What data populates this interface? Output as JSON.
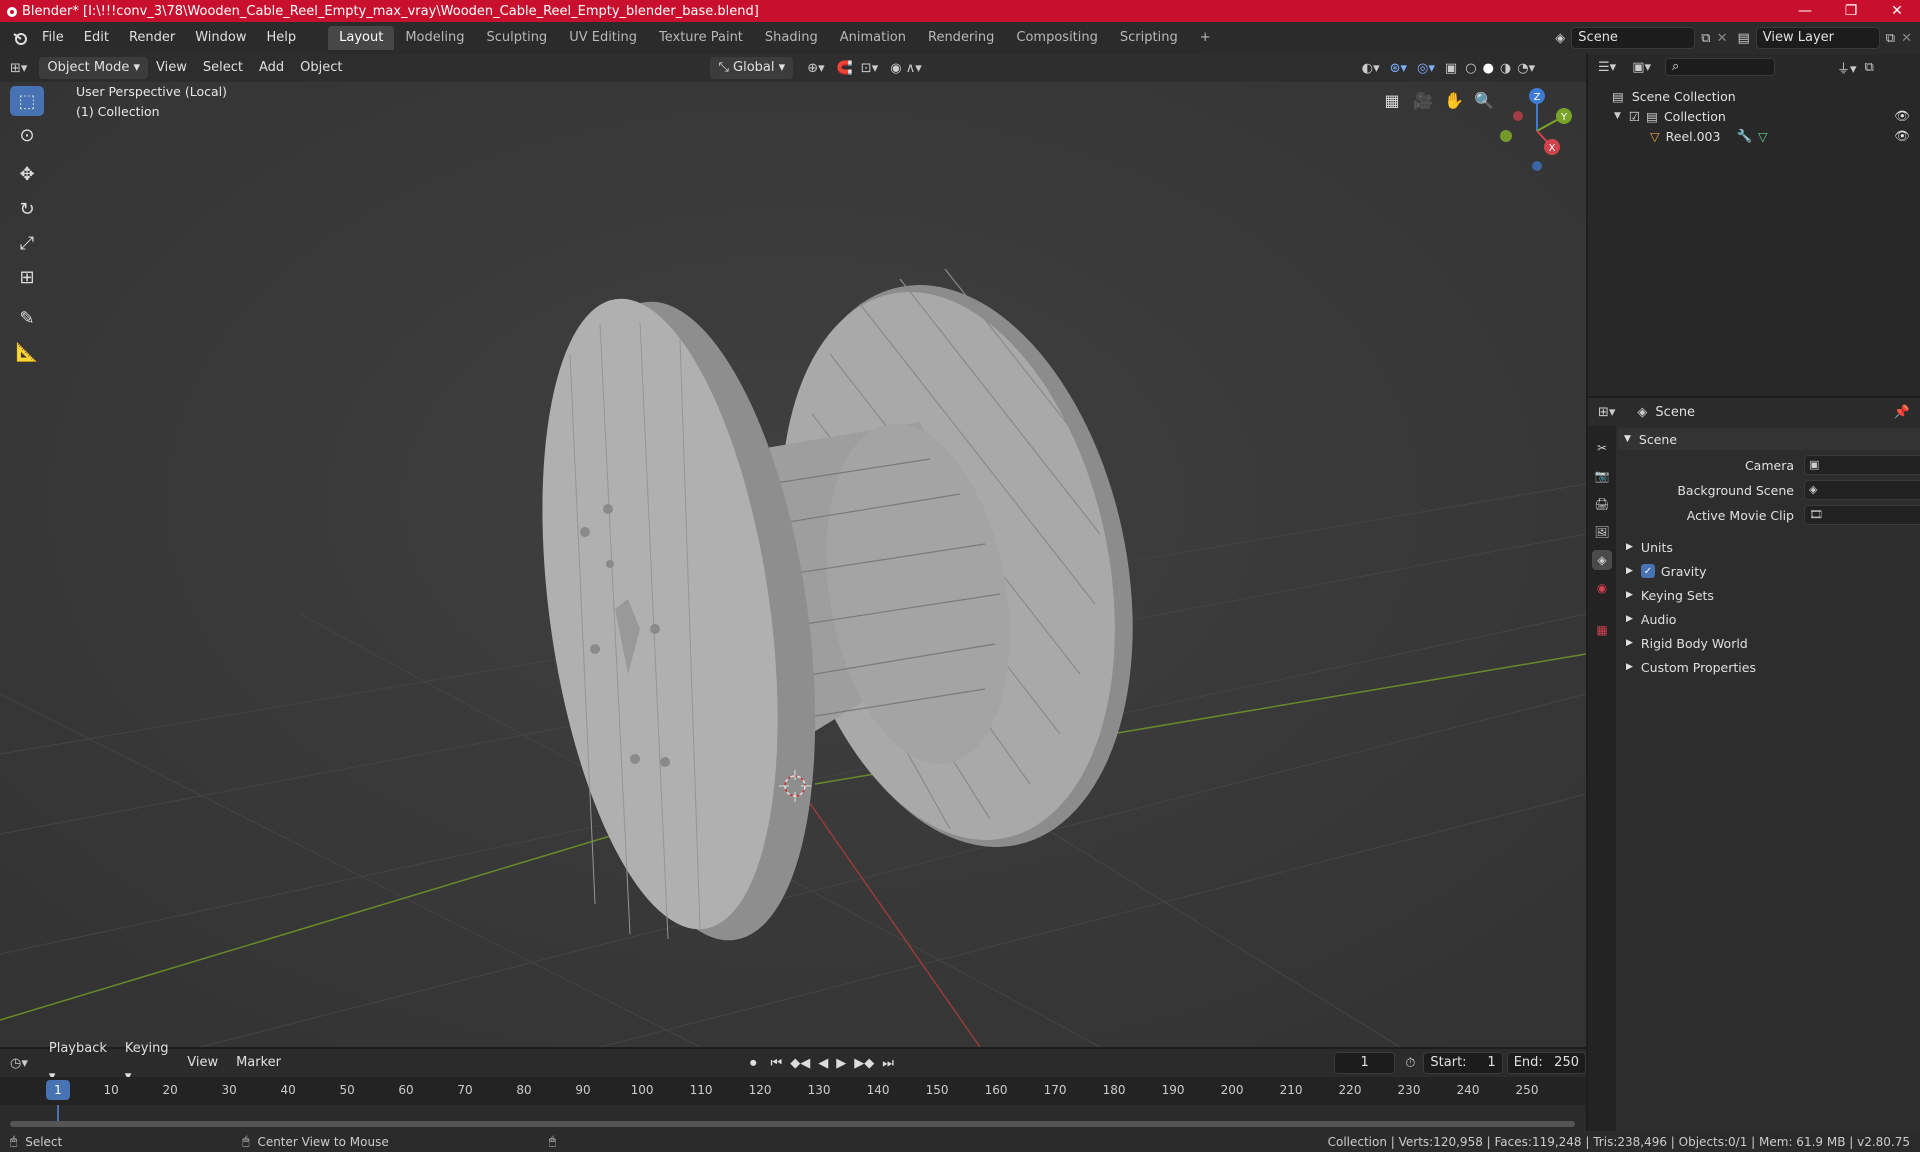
{
  "window": {
    "title": "Blender* [I:\\!!!conv_3\\78\\Wooden_Cable_Reel_Empty_max_vray\\Wooden_Cable_Reel_Empty_blender_base.blend]",
    "minimize": "—",
    "maximize": "❐",
    "close": "✕"
  },
  "menu": [
    "File",
    "Edit",
    "Render",
    "Window",
    "Help"
  ],
  "workspaces": [
    "Layout",
    "Modeling",
    "Sculpting",
    "UV Editing",
    "Texture Paint",
    "Shading",
    "Animation",
    "Rendering",
    "Compositing",
    "Scripting"
  ],
  "workspace_add": "+",
  "scene_selector": {
    "scene": "Scene",
    "view_layer": "View Layer"
  },
  "viewport": {
    "mode": "Object Mode",
    "menus": [
      "View",
      "Select",
      "Add",
      "Object"
    ],
    "orientation": "Global",
    "overlay_line1": "User Perspective (Local)",
    "overlay_line2": "(1) Collection",
    "gizmo_axes": {
      "x": "X",
      "y": "Y",
      "z": "Z"
    },
    "bg_color": "#393939",
    "grid_x_color": "#9a3a3a",
    "grid_y_color": "#6a8a2a"
  },
  "tools": [
    "select-box",
    "cursor",
    "move",
    "rotate",
    "scale",
    "transform",
    "annotate",
    "measure"
  ],
  "outliner": {
    "root": "Scene Collection",
    "collection": "Collection",
    "object": "Reel.003"
  },
  "properties": {
    "header": "Scene",
    "panel": "Scene",
    "camera_label": "Camera",
    "background_label": "Background Scene",
    "movieclip_label": "Active Movie Clip",
    "sections": [
      "Units",
      "Gravity",
      "Keying Sets",
      "Audio",
      "Rigid Body World",
      "Custom Properties"
    ]
  },
  "timeline": {
    "menus": [
      "Playback",
      "Keying",
      "View",
      "Marker"
    ],
    "current_frame": "1",
    "start_label": "Start:",
    "start": "1",
    "end_label": "End:",
    "end": "250",
    "ticks": [
      "1",
      "10",
      "20",
      "30",
      "40",
      "50",
      "60",
      "70",
      "80",
      "90",
      "100",
      "110",
      "120",
      "130",
      "140",
      "150",
      "160",
      "170",
      "180",
      "190",
      "200",
      "210",
      "220",
      "230",
      "240",
      "250"
    ]
  },
  "status": {
    "left1": "Select",
    "left2": "Center View to Mouse",
    "right": "Collection | Verts:120,958 | Faces:119,248 | Tris:238,496 | Objects:0/1 | Mem: 61.9 MB | v2.80.75"
  },
  "colors": {
    "accent": "#4772b3",
    "titlebar": "#c8102e"
  }
}
